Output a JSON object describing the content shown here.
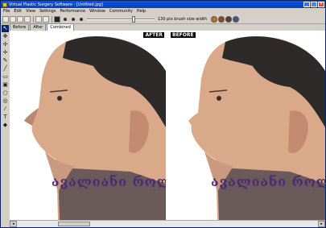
{
  "window": {
    "title": "Virtual Plastic Surgery Software - [Untitled.jpg]"
  },
  "menu": [
    "File",
    "Edit",
    "View",
    "Settings",
    "Performance",
    "Window",
    "Community",
    "Help"
  ],
  "toolbar": {
    "brush_label": "130 pix brush size width",
    "brush_level": 0.7
  },
  "tabs": [
    {
      "label": "Before",
      "active": false
    },
    {
      "label": "After",
      "active": false
    },
    {
      "label": "Combined",
      "active": true
    }
  ],
  "panes": {
    "left": {
      "label": "AFTER"
    },
    "right": {
      "label": "BEFORE"
    }
  },
  "overlay_text": "ავალიანი როლანდ",
  "colors": {
    "title": "#0a55d8",
    "overlay_text": "#4a2a78"
  }
}
